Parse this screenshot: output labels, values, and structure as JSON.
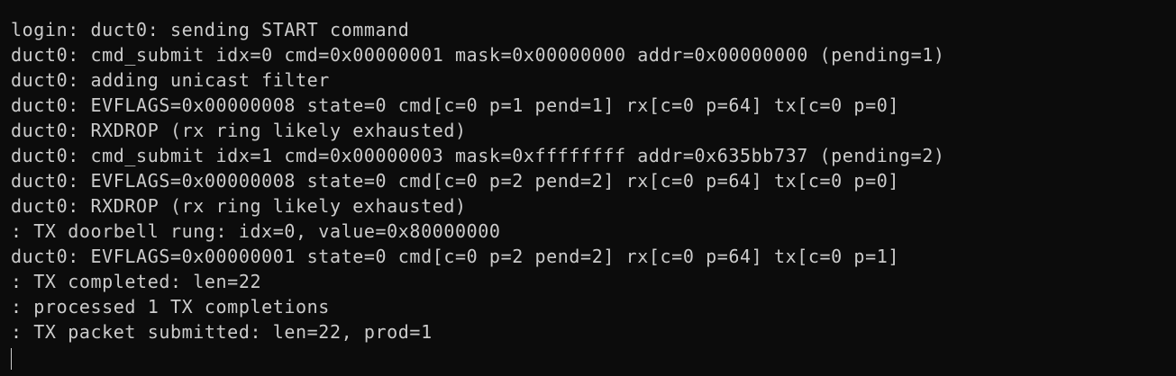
{
  "terminal": {
    "lines": [
      "login: duct0: sending START command",
      "duct0: cmd_submit idx=0 cmd=0x00000001 mask=0x00000000 addr=0x00000000 (pending=1)",
      "duct0: adding unicast filter",
      "duct0: EVFLAGS=0x00000008 state=0 cmd[c=0 p=1 pend=1] rx[c=0 p=64] tx[c=0 p=0]",
      "duct0: RXDROP (rx ring likely exhausted)",
      "duct0: cmd_submit idx=1 cmd=0x00000003 mask=0xffffffff addr=0x635bb737 (pending=2)",
      "duct0: EVFLAGS=0x00000008 state=0 cmd[c=0 p=2 pend=2] rx[c=0 p=64] tx[c=0 p=0]",
      "duct0: RXDROP (rx ring likely exhausted)",
      ": TX doorbell rung: idx=0, value=0x80000000",
      "duct0: EVFLAGS=0x00000001 state=0 cmd[c=0 p=2 pend=2] rx[c=0 p=64] tx[c=0 p=1]",
      ": TX completed: len=22",
      ": processed 1 TX completions",
      ": TX packet submitted: len=22, prod=1"
    ],
    "background_color": "#0c0c0c",
    "text_color": "#cccccc"
  }
}
